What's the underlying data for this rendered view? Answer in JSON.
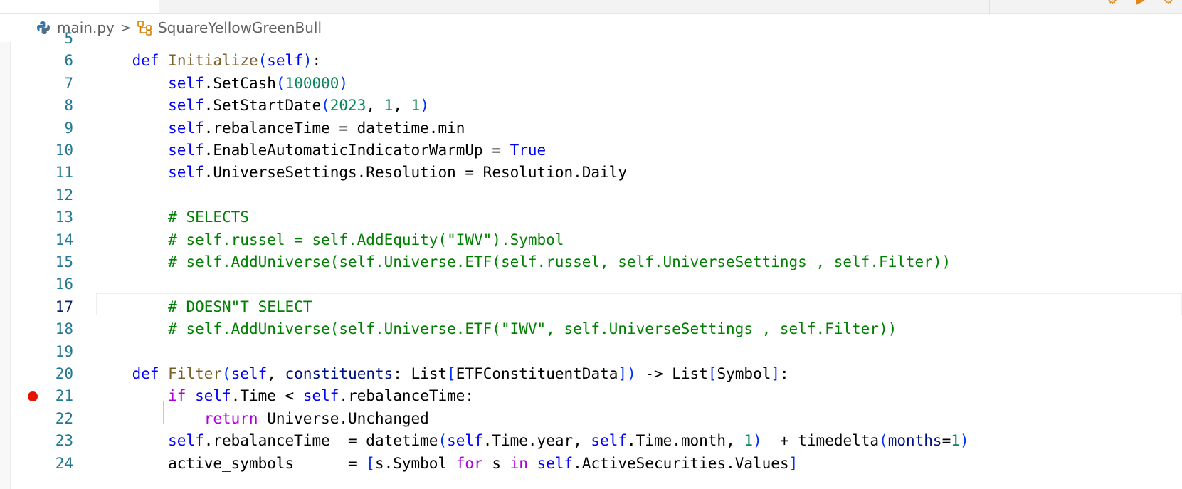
{
  "breadcrumb": {
    "file": "main.py",
    "separator": ">",
    "class_name": "SquareYellowGreenBull",
    "file_icon": "python-icon",
    "class_icon": "symbol-class-icon"
  },
  "editor": {
    "current_line": "17",
    "breakpoint_line": "21",
    "lines": [
      {
        "n": "5",
        "segs": []
      },
      {
        "n": "6",
        "segs": [
          [
            "txt",
            "    "
          ],
          [
            "kw",
            "def"
          ],
          [
            "txt",
            " "
          ],
          [
            "fn",
            "Initialize"
          ],
          [
            "b1",
            "("
          ],
          [
            "self",
            "self"
          ],
          [
            "b1",
            ")"
          ],
          [
            "txt",
            ":"
          ]
        ]
      },
      {
        "n": "7",
        "segs": [
          [
            "txt",
            "        "
          ],
          [
            "self",
            "self"
          ],
          [
            "txt",
            ".SetCash"
          ],
          [
            "b1",
            "("
          ],
          [
            "num",
            "100000"
          ],
          [
            "b1",
            ")"
          ]
        ]
      },
      {
        "n": "8",
        "segs": [
          [
            "txt",
            "        "
          ],
          [
            "self",
            "self"
          ],
          [
            "txt",
            ".SetStartDate"
          ],
          [
            "b1",
            "("
          ],
          [
            "num",
            "2023"
          ],
          [
            "txt",
            ", "
          ],
          [
            "num",
            "1"
          ],
          [
            "txt",
            ", "
          ],
          [
            "num",
            "1"
          ],
          [
            "b1",
            ")"
          ]
        ]
      },
      {
        "n": "9",
        "segs": [
          [
            "txt",
            "        "
          ],
          [
            "self",
            "self"
          ],
          [
            "txt",
            ".rebalanceTime = datetime.min"
          ]
        ]
      },
      {
        "n": "10",
        "segs": [
          [
            "txt",
            "        "
          ],
          [
            "self",
            "self"
          ],
          [
            "txt",
            ".EnableAutomaticIndicatorWarmUp = "
          ],
          [
            "kw",
            "True"
          ]
        ]
      },
      {
        "n": "11",
        "segs": [
          [
            "txt",
            "        "
          ],
          [
            "self",
            "self"
          ],
          [
            "txt",
            ".UniverseSettings.Resolution = Resolution.Daily"
          ]
        ]
      },
      {
        "n": "12",
        "segs": []
      },
      {
        "n": "13",
        "segs": [
          [
            "txt",
            "        "
          ],
          [
            "cmt",
            "# SELECTS"
          ]
        ]
      },
      {
        "n": "14",
        "segs": [
          [
            "txt",
            "        "
          ],
          [
            "cmt",
            "# self.russel = self.AddEquity(\"IWV\").Symbol"
          ]
        ]
      },
      {
        "n": "15",
        "segs": [
          [
            "txt",
            "        "
          ],
          [
            "cmt",
            "# self.AddUniverse(self.Universe.ETF(self.russel, self.UniverseSettings , self.Filter))"
          ]
        ]
      },
      {
        "n": "16",
        "segs": []
      },
      {
        "n": "17",
        "segs": [
          [
            "txt",
            "        "
          ],
          [
            "cmt",
            "# DOESN\"T SELECT"
          ]
        ]
      },
      {
        "n": "18",
        "segs": [
          [
            "txt",
            "        "
          ],
          [
            "cmt",
            "# self.AddUniverse(self.Universe.ETF(\"IWV\", self.UniverseSettings , self.Filter))"
          ]
        ]
      },
      {
        "n": "19",
        "segs": []
      },
      {
        "n": "20",
        "segs": [
          [
            "txt",
            "    "
          ],
          [
            "kw",
            "def"
          ],
          [
            "txt",
            " "
          ],
          [
            "fn",
            "Filter"
          ],
          [
            "b1",
            "("
          ],
          [
            "self",
            "self"
          ],
          [
            "txt",
            ", "
          ],
          [
            "par",
            "constituents"
          ],
          [
            "txt",
            ": List"
          ],
          [
            "b1",
            "["
          ],
          [
            "txt",
            "ETFConstituentData"
          ],
          [
            "b1",
            "]"
          ],
          [
            "b1",
            ")"
          ],
          [
            "txt",
            " -> List"
          ],
          [
            "b1",
            "["
          ],
          [
            "txt",
            "Symbol"
          ],
          [
            "b1",
            "]"
          ],
          [
            "txt",
            ":"
          ]
        ]
      },
      {
        "n": "21",
        "segs": [
          [
            "txt",
            "        "
          ],
          [
            "ctl",
            "if"
          ],
          [
            "txt",
            " "
          ],
          [
            "self",
            "self"
          ],
          [
            "txt",
            ".Time < "
          ],
          [
            "self",
            "self"
          ],
          [
            "txt",
            ".rebalanceTime:"
          ]
        ]
      },
      {
        "n": "22",
        "segs": [
          [
            "txt",
            "            "
          ],
          [
            "ctl",
            "return"
          ],
          [
            "txt",
            " Universe.Unchanged"
          ]
        ]
      },
      {
        "n": "23",
        "segs": [
          [
            "txt",
            "        "
          ],
          [
            "self",
            "self"
          ],
          [
            "txt",
            ".rebalanceTime  = datetime"
          ],
          [
            "b1",
            "("
          ],
          [
            "self",
            "self"
          ],
          [
            "txt",
            ".Time.year, "
          ],
          [
            "self",
            "self"
          ],
          [
            "txt",
            ".Time.month, "
          ],
          [
            "num",
            "1"
          ],
          [
            "b1",
            ")"
          ],
          [
            "txt",
            "  + timedelta"
          ],
          [
            "b1",
            "("
          ],
          [
            "par",
            "months"
          ],
          [
            "txt",
            "="
          ],
          [
            "num",
            "1"
          ],
          [
            "b1",
            ")"
          ]
        ]
      },
      {
        "n": "24",
        "segs": [
          [
            "txt",
            "        active_symbols      = "
          ],
          [
            "b1",
            "["
          ],
          [
            "txt",
            "s.Symbol "
          ],
          [
            "ctl",
            "for"
          ],
          [
            "txt",
            " s "
          ],
          [
            "ctl",
            "in"
          ],
          [
            "txt",
            " "
          ],
          [
            "self",
            "self"
          ],
          [
            "txt",
            ".ActiveSecurities.Values"
          ],
          [
            "b1",
            "]"
          ]
        ]
      }
    ]
  }
}
